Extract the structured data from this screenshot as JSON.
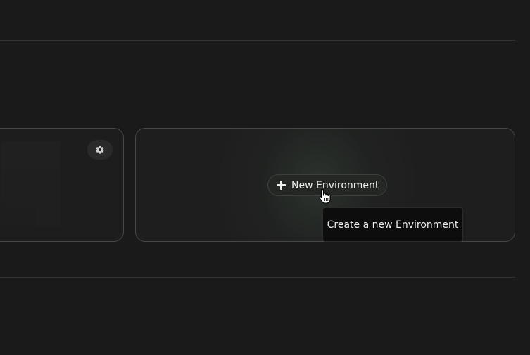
{
  "environments": {
    "create_button_label": "New Environment",
    "create_tooltip": "Create a new Environment",
    "settings_icon": "gear-icon",
    "plus_icon": "plus-icon"
  }
}
